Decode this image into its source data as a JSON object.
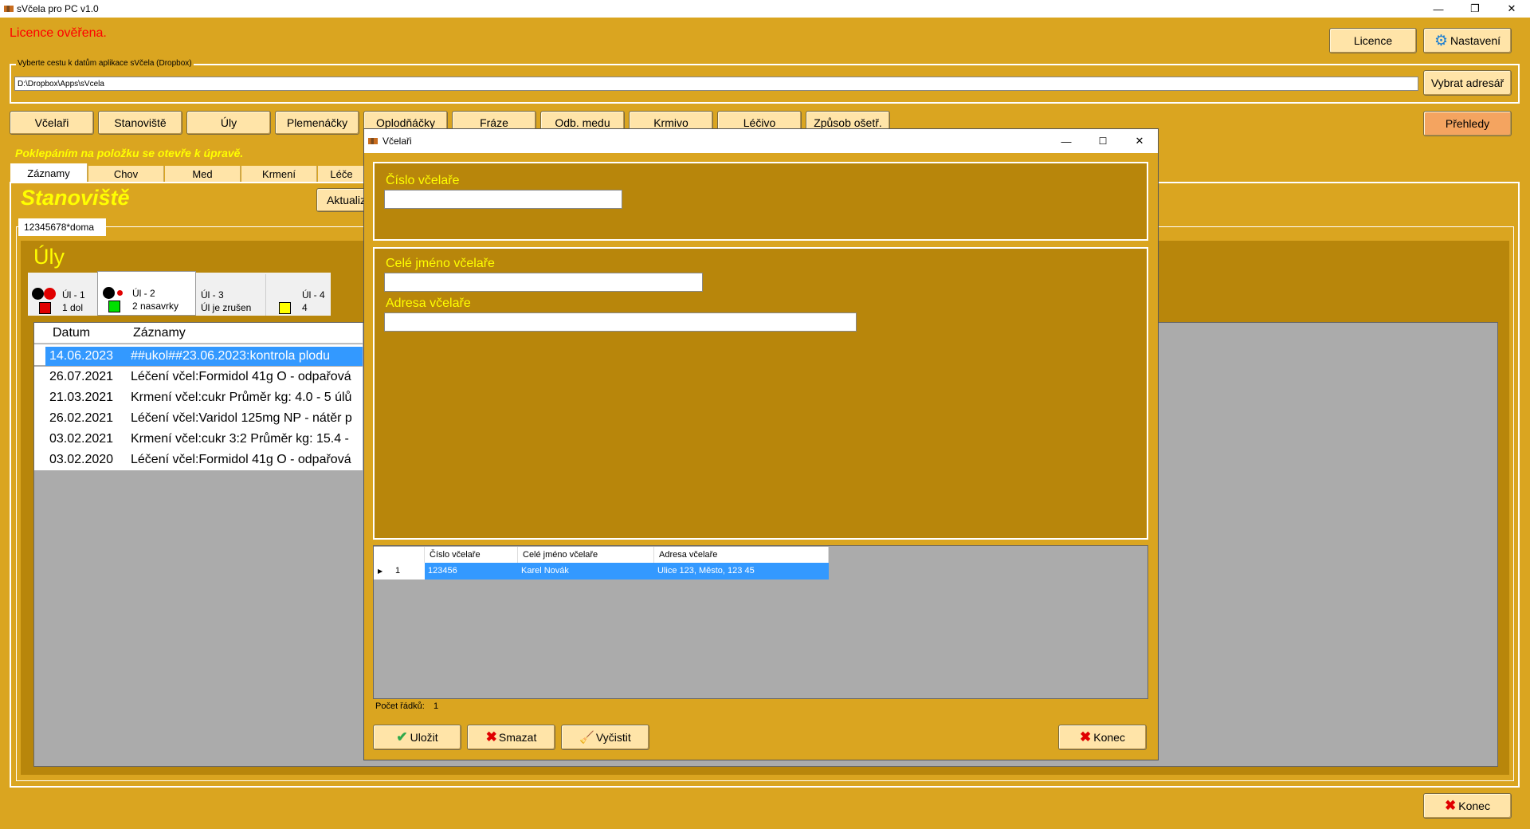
{
  "window": {
    "title": "sVčela pro PC v1.0",
    "minimize": "—",
    "restore": "❐",
    "close": "✕"
  },
  "license_status": "Licence ověřena.",
  "top_buttons": {
    "licence": "Licence",
    "settings": "Nastavení"
  },
  "path": {
    "label": "Vyberte cestu k datům aplikace sVčela (Dropbox)",
    "value": "D:\\Dropbox\\Apps\\sVcela",
    "browse": "Vybrat adresář"
  },
  "nav": [
    {
      "label": "Včelaři"
    },
    {
      "label": "Stanoviště"
    },
    {
      "label": "Úly"
    },
    {
      "label": "Plemenáčky"
    },
    {
      "label": "Oplodňáčky"
    },
    {
      "label": "Fráze"
    },
    {
      "label": "Odb. medu"
    },
    {
      "label": "Krmivo"
    },
    {
      "label": "Léčivo"
    },
    {
      "label": "Způsob ošetř."
    }
  ],
  "overview_button": "Přehledy",
  "hint": "Poklepáním na položku se otevře k úpravě.",
  "record_tabs": [
    {
      "label": "Záznamy"
    },
    {
      "label": "Chov"
    },
    {
      "label": "Med"
    },
    {
      "label": "Krmení"
    },
    {
      "label": "Léče"
    }
  ],
  "stanoviste": {
    "title": "Stanoviště",
    "refresh": "Aktualiz",
    "tab": "12345678*doma"
  },
  "uly": {
    "title": "Úly",
    "hives": [
      {
        "name": "Úl - 1",
        "info": "1 dol"
      },
      {
        "name": "Úl - 2",
        "info": "2 nasavrky"
      },
      {
        "name": "Úl - 3",
        "info": "Úl je zrušen"
      },
      {
        "name": "Úl - 4",
        "info": "4"
      }
    ]
  },
  "records": {
    "headers": [
      "Datum",
      "Záznamy"
    ],
    "rows": [
      {
        "date": "14.06.2023",
        "text": "##ukol##23.06.2023:kontrola plodu"
      },
      {
        "date": "26.07.2021",
        "text": "Léčení včel:Formidol 41g O - odpařová"
      },
      {
        "date": "21.03.2021",
        "text": "Krmení včel:cukr Průměr kg: 4.0 - 5 úlů"
      },
      {
        "date": "26.02.2021",
        "text": "Léčení včel:Varidol 125mg NP - nátěr p"
      },
      {
        "date": "03.02.2021",
        "text": "Krmení včel:cukr 3:2 Průměr kg: 15.4 -"
      },
      {
        "date": "03.02.2020",
        "text": "Léčení včel:Formidol 41g O - odpařová"
      }
    ]
  },
  "bottom_close": "Konec",
  "dialog": {
    "title": "Včelaři",
    "fields": {
      "number_label": "Číslo včelaře",
      "number_value": "",
      "name_label": "Celé jméno včelaře",
      "name_value": "",
      "address_label": "Adresa včelaře",
      "address_value": ""
    },
    "table": {
      "headers": [
        "Číslo včelaře",
        "Celé jméno včelaře",
        "Adresa včelaře"
      ],
      "rows": [
        {
          "row_no": "1",
          "number": "123456",
          "name": "Karel Novák",
          "address": "Ulice 123, Město, 123 45"
        }
      ]
    },
    "row_count_label": "Počet řádků:",
    "row_count": "1",
    "buttons": {
      "save": "Uložit",
      "delete": "Smazat",
      "clear": "Vyčistit",
      "close": "Konec"
    }
  },
  "colors": {
    "background": "#DAA520",
    "button": "#FFE4A8",
    "overview_button": "#F4A460",
    "group_box": "#B8860B",
    "license_text": "#FF0000",
    "accent_yellow": "#FFFF00",
    "selection": "#3399FF"
  }
}
